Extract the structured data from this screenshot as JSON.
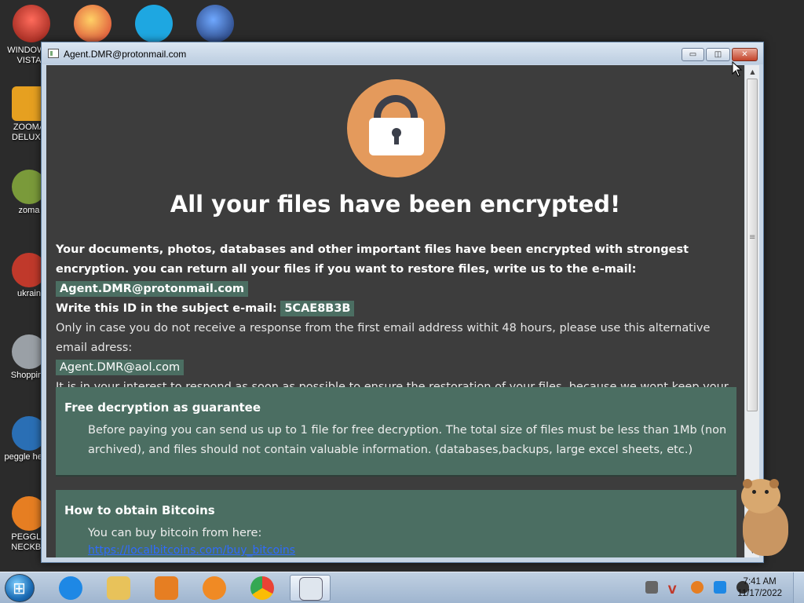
{
  "desktop": {
    "icons": [
      {
        "label": "WINDOWS VISTA",
        "color": "#c0392b"
      },
      {
        "label": "ZOOMA DELUXE",
        "color": "#e6a020"
      },
      {
        "label": "zoma",
        "color": "#7a9a3a"
      },
      {
        "label": "ukrain",
        "color": "#c0392b"
      },
      {
        "label": "Shopping",
        "color": "#9aa0a6"
      },
      {
        "label": "peggle heggl",
        "color": "#2a6fb5"
      },
      {
        "label": "PEGGLE NECKBE",
        "color": "#e67e22"
      }
    ],
    "top_icons": [
      {
        "name": "peggle-icon",
        "color": "#d63a2f"
      },
      {
        "name": "skype-icon",
        "color": "#1ea7e1"
      },
      {
        "name": "globe-icon",
        "color": "#2a4f8f"
      }
    ]
  },
  "window": {
    "title": "Agent.DMR@protonmail.com",
    "minimize_glyph": "▭",
    "maximize_glyph": "◫",
    "close_glyph": "✕"
  },
  "ransom": {
    "headline": "All your files have been encrypted!",
    "para1_bold": "Your documents, photos, databases and other important files have been encrypted with strongest encryption. you can return all your files if you want to restore files, write us to the e-mail:",
    "email_primary": "Agent.DMR@protonmail.com",
    "id_label": "Write this ID in the subject e-mail:",
    "id_value": "5CAE8B3B",
    "alt_text": "Only in case you do not receive a response from the first email address withit 48 hours, please use this alternative email adress:",
    "email_alt": "Agent.DMR@aol.com",
    "interest_text": "It is in your interest to respond as soon as possible to ensure the restoration of your files, because we wont keep your decryption keys at our server more than one week. The price depends on how fast you write to us.",
    "panel1_title": "Free decryption as guarantee",
    "panel1_body": "Before paying you can send us up to 1 file for free decryption. The total size of files must be less than 1Mb (non archived), and files should not contain valuable information. (databases,backups, large excel sheets, etc.)",
    "panel2_title": "How to obtain Bitcoins",
    "panel2_body": "You can buy bitcoin from here:",
    "panel2_link": "https://localbitcoins.com/buy_bitcoins"
  },
  "colors": {
    "background": "#3d3d3d",
    "accent_panel": "#4b6e62",
    "lock_circle": "#e49a5c"
  },
  "taskbar": {
    "apps": [
      {
        "name": "ie-icon",
        "color": "#1e88e5"
      },
      {
        "name": "explorer-icon",
        "color": "#e8c25a"
      },
      {
        "name": "media-player-icon",
        "color": "#e67e22"
      },
      {
        "name": "uc-browser-icon",
        "color": "#f08a24"
      },
      {
        "name": "chrome-icon",
        "color": "#34a853"
      },
      {
        "name": "ransom-window-icon",
        "color": "#dfe6ee"
      }
    ],
    "time": "7:41 AM",
    "date": "11/17/2022"
  }
}
